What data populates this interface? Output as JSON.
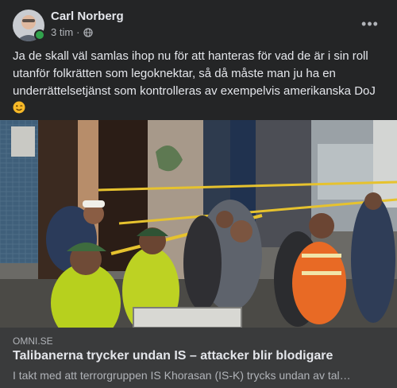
{
  "post": {
    "author": "Carl Norberg",
    "time": "3 tim",
    "separator": "·",
    "more_label": "•••",
    "text": "Ja de skall väl samlas ihop nu för att hanteras för vad de är i sin roll utanför folkrätten som legoknektar, så då måste man ju ha en underrättelsetjänst som kontrolleras av exempelvis amerikanska DoJ"
  },
  "link": {
    "domain": "OMNI.SE",
    "title": "Talibanerna trycker undan IS – attacker blir blodigare",
    "description": "I takt med att terrorgruppen IS Khorasan (IS-K) trycks undan av tal…"
  },
  "icons": {
    "privacy": "globe-icon",
    "emoji": "winking-face-icon",
    "more": "more-options-icon"
  },
  "colors": {
    "background": "#242526",
    "preview_background": "#3a3b3c",
    "online": "#31a24c"
  }
}
